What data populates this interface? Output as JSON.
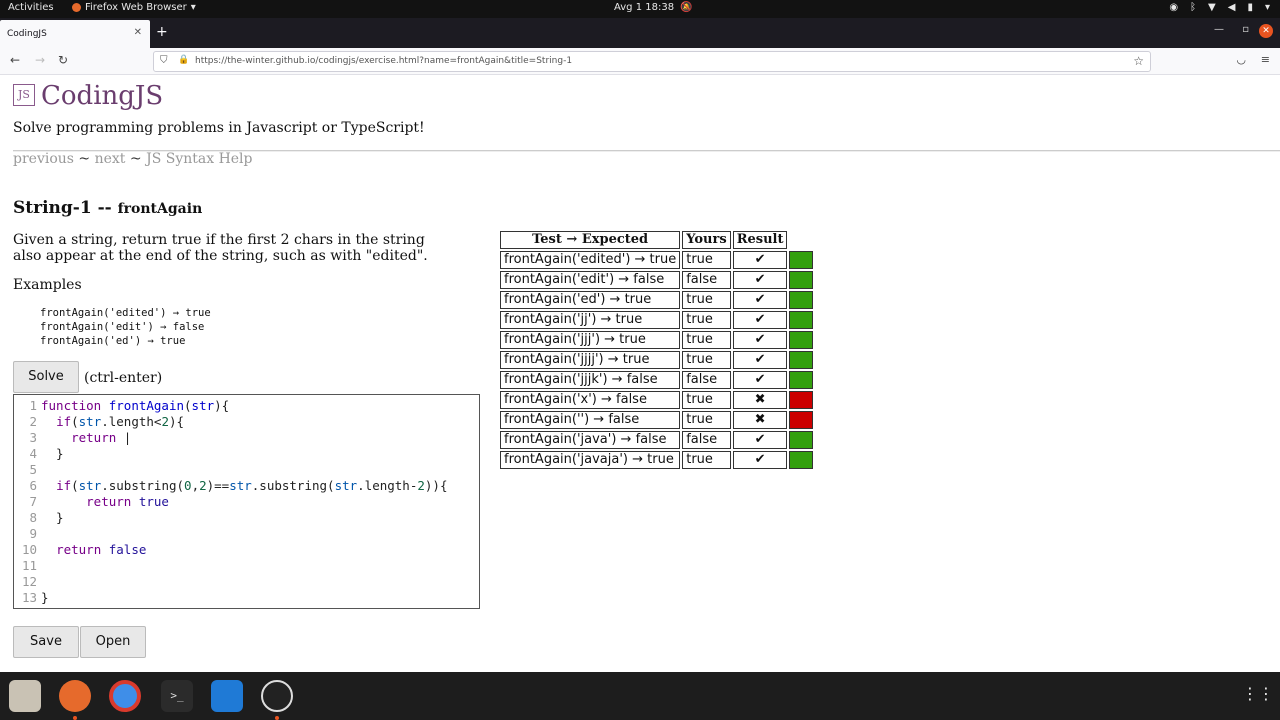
{
  "topbar": {
    "activities": "Activities",
    "app_menu": "Firefox Web Browser",
    "clock": "Avg 1  18:38"
  },
  "browser": {
    "tab_title": "CodingJS",
    "url": "https://the-winter.github.io/codingjs/exercise.html?name=frontAgain&title=String-1"
  },
  "page": {
    "site_title": "CodingJS",
    "tagline": "Solve programming problems in Javascript or TypeScript!",
    "nav": {
      "previous": "previous",
      "next": "next",
      "help": "JS Syntax Help",
      "sep": "~"
    },
    "heading": "String-1 --",
    "heading_sub": "frontAgain",
    "description": "Given a string, return true if the first 2 chars in the string also appear at the end of the string, such as with \"edited\".",
    "examples_label": "Examples",
    "examples": [
      "frontAgain('edited') → true",
      "frontAgain('edit') → false",
      "frontAgain('ed') → true"
    ],
    "solve_label": "Solve",
    "solve_hint": "(ctrl-enter)",
    "save_label": "Save",
    "open_label": "Open"
  },
  "editor": {
    "line_numbers": [
      "1",
      "2",
      "3",
      "4",
      "5",
      "6",
      "7",
      "8",
      "9",
      "10",
      "11",
      "12",
      "13"
    ]
  },
  "results": {
    "headers": [
      "Test → Expected",
      "Yours",
      "Result"
    ],
    "rows": [
      {
        "test": "frontAgain('edited') → true",
        "yours": "true",
        "mark": "✔",
        "pass": true
      },
      {
        "test": "frontAgain('edit') → false",
        "yours": "false",
        "mark": "✔",
        "pass": true
      },
      {
        "test": "frontAgain('ed') → true",
        "yours": "true",
        "mark": "✔",
        "pass": true
      },
      {
        "test": "frontAgain('jj') → true",
        "yours": "true",
        "mark": "✔",
        "pass": true
      },
      {
        "test": "frontAgain('jjj') → true",
        "yours": "true",
        "mark": "✔",
        "pass": true
      },
      {
        "test": "frontAgain('jjjj') → true",
        "yours": "true",
        "mark": "✔",
        "pass": true
      },
      {
        "test": "frontAgain('jjjk') → false",
        "yours": "false",
        "mark": "✔",
        "pass": true
      },
      {
        "test": "frontAgain('x') → false",
        "yours": "true",
        "mark": "✖",
        "pass": false
      },
      {
        "test": "frontAgain('') → false",
        "yours": "true",
        "mark": "✖",
        "pass": false
      },
      {
        "test": "frontAgain('java') → false",
        "yours": "false",
        "mark": "✔",
        "pass": true
      },
      {
        "test": "frontAgain('javaja') → true",
        "yours": "true",
        "mark": "✔",
        "pass": true
      }
    ],
    "pass_color": "#33a00d",
    "fail_color": "#cc0000"
  },
  "dock": {
    "apps": [
      "files-icon",
      "firefox-icon",
      "chrome-icon",
      "terminal-icon",
      "vscode-icon",
      "obs-icon"
    ]
  }
}
